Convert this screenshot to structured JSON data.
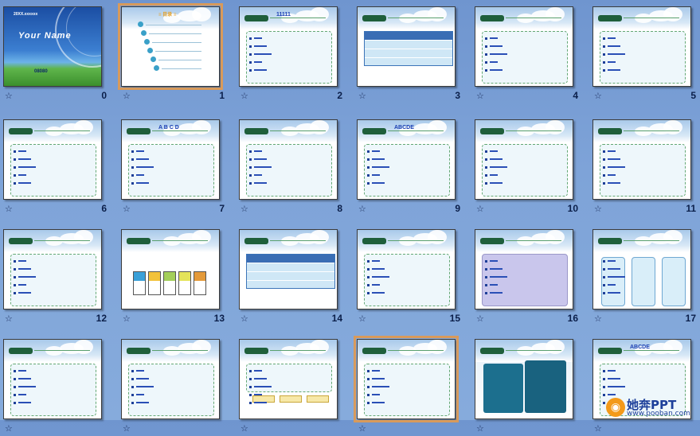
{
  "slides": [
    {
      "number": "0",
      "kind": "title",
      "top_text": "20XX.xxxxxx",
      "name": "Your Name",
      "date": "08080",
      "selected": false
    },
    {
      "number": "1",
      "kind": "agenda",
      "heading": "≡ 目录 ≡",
      "selected": true
    },
    {
      "number": "2",
      "kind": "content",
      "heading": "11111",
      "selected": false
    },
    {
      "number": "3",
      "kind": "table",
      "selected": false
    },
    {
      "number": "4",
      "kind": "content",
      "selected": false
    },
    {
      "number": "5",
      "kind": "content",
      "selected": false
    },
    {
      "number": "6",
      "kind": "content",
      "selected": false
    },
    {
      "number": "7",
      "kind": "content",
      "heading": "A B C D",
      "selected": false
    },
    {
      "number": "8",
      "kind": "content",
      "selected": false
    },
    {
      "number": "9",
      "kind": "content",
      "heading": "ABCDE",
      "selected": false
    },
    {
      "number": "10",
      "kind": "content",
      "selected": false
    },
    {
      "number": "11",
      "kind": "content",
      "selected": false
    },
    {
      "number": "12",
      "kind": "content",
      "selected": false
    },
    {
      "number": "13",
      "kind": "boxes",
      "selected": false
    },
    {
      "number": "14",
      "kind": "table",
      "selected": false
    },
    {
      "number": "15",
      "kind": "content",
      "selected": false
    },
    {
      "number": "16",
      "kind": "map",
      "selected": false
    },
    {
      "number": "17",
      "kind": "columns",
      "selected": false
    },
    {
      "number": "",
      "kind": "content",
      "selected": false
    },
    {
      "number": "",
      "kind": "content",
      "selected": false
    },
    {
      "number": "",
      "kind": "flow",
      "selected": false
    },
    {
      "number": "",
      "kind": "content",
      "selected": true
    },
    {
      "number": "",
      "kind": "book",
      "selected": false
    },
    {
      "number": "",
      "kind": "content",
      "heading": "ABCDE",
      "selected": false
    }
  ],
  "watermark": {
    "title": "她奔PPT",
    "url": "www.pooban.com"
  },
  "icons": {
    "star": "slide-transition-star-icon",
    "logo": "pooban-logo-icon"
  },
  "colors": {
    "background": "#7ea3d8",
    "selection": "#d89a5b",
    "accent": "#1f5f3b",
    "bullet": "#1d3f98"
  }
}
